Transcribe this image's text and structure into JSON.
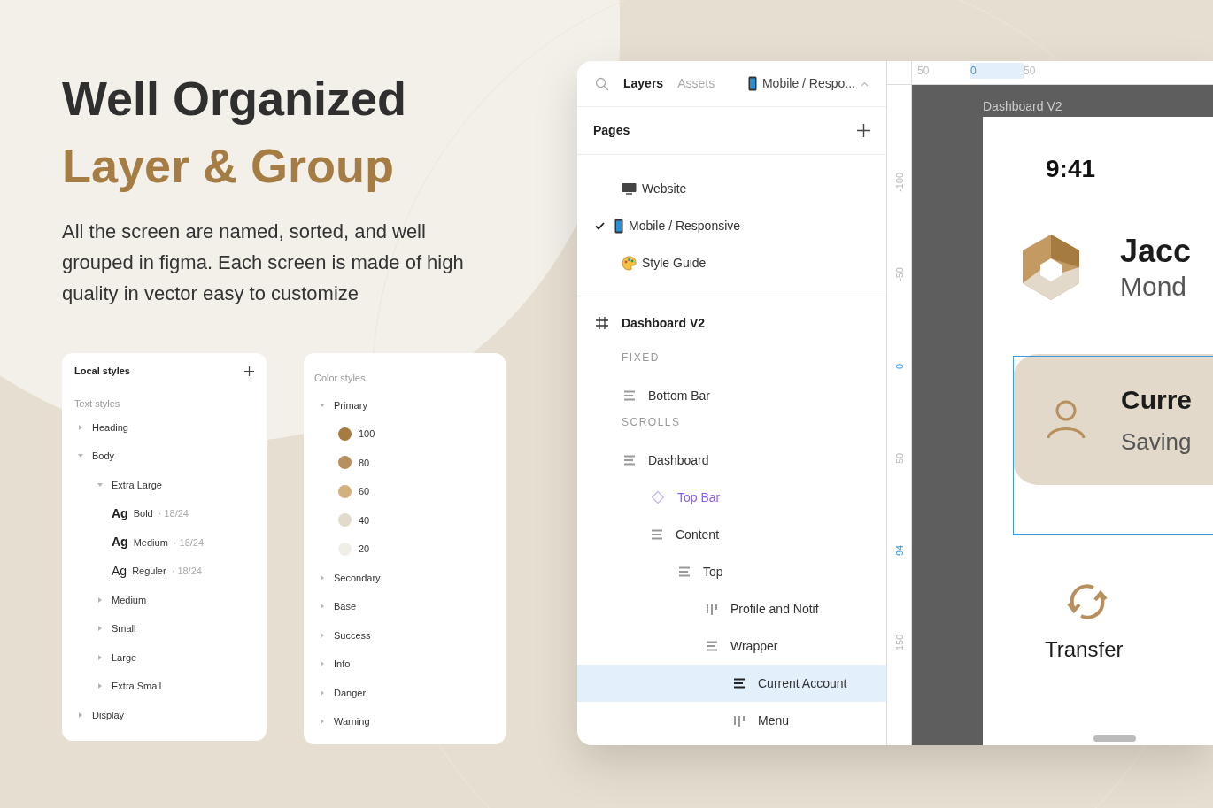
{
  "headline": {
    "line_1": "Well Organized",
    "line_2": "Layer & Group"
  },
  "description": "All the screen are named, sorted, and well grouped in figma. Each screen is made of high quality in vector easy to customize",
  "local_styles": {
    "title": "Local styles",
    "section": "Text styles",
    "items": [
      {
        "kind": "group",
        "label": "Heading",
        "expanded": false
      },
      {
        "kind": "group",
        "label": "Body",
        "expanded": true,
        "children": [
          {
            "kind": "group",
            "label": "Extra Large",
            "expanded": true,
            "children": [
              {
                "kind": "style",
                "sample": "Ag",
                "label": "Bold",
                "spec": "· 18/24"
              },
              {
                "kind": "style",
                "sample": "Ag",
                "label": "Medium",
                "spec": "· 18/24"
              },
              {
                "kind": "style",
                "sample": "Ag",
                "label": "Reguler",
                "spec": "· 18/24"
              }
            ]
          },
          {
            "kind": "group",
            "label": "Medium",
            "expanded": false
          },
          {
            "kind": "group",
            "label": "Small",
            "expanded": false
          },
          {
            "kind": "group",
            "label": "Large",
            "expanded": false
          },
          {
            "kind": "group",
            "label": "Extra Small",
            "expanded": false
          }
        ]
      },
      {
        "kind": "group",
        "label": "Display",
        "expanded": false
      }
    ]
  },
  "color_styles": {
    "title": "Color styles",
    "items": [
      {
        "kind": "group",
        "label": "Primary",
        "expanded": true,
        "children": [
          {
            "kind": "swatch",
            "label": "100",
            "color": "#a57b42"
          },
          {
            "kind": "swatch",
            "label": "80",
            "color": "#b8905e"
          },
          {
            "kind": "swatch",
            "label": "60",
            "color": "#d3b07f"
          },
          {
            "kind": "swatch",
            "label": "40",
            "color": "#e2dacd"
          },
          {
            "kind": "swatch",
            "label": "20",
            "color": "#f1eee8"
          }
        ]
      },
      {
        "kind": "group",
        "label": "Secondary",
        "expanded": false
      },
      {
        "kind": "group",
        "label": "Base",
        "expanded": false
      },
      {
        "kind": "group",
        "label": "Success",
        "expanded": false
      },
      {
        "kind": "group",
        "label": "Info",
        "expanded": false
      },
      {
        "kind": "group",
        "label": "Danger",
        "expanded": false
      },
      {
        "kind": "group",
        "label": "Warning",
        "expanded": false
      }
    ]
  },
  "figma": {
    "tabs": [
      {
        "label": "Layers",
        "selected": true
      },
      {
        "label": "Assets",
        "selected": false
      }
    ],
    "page_picker": "Mobile / Respo...",
    "pages_title": "Pages",
    "pages": [
      {
        "label": "Website",
        "kind": "desktop",
        "selected": false
      },
      {
        "label": "Mobile / Responsive",
        "kind": "phone",
        "selected": true
      },
      {
        "label": "Style Guide",
        "kind": "palette",
        "selected": false
      }
    ],
    "frame": "Dashboard V2",
    "sections": [
      {
        "label": "FIXED",
        "layers": [
          {
            "label": "Bottom Bar",
            "kind": "stack_v",
            "selected": false
          }
        ]
      },
      {
        "label": "SCROLLS",
        "layers": [
          {
            "label": "Dashboard",
            "kind": "stack_v",
            "selected": false,
            "children": [
              {
                "label": "Top Bar",
                "kind": "component",
                "selected": false
              },
              {
                "label": "Content",
                "kind": "stack_v",
                "selected": false,
                "children": [
                  {
                    "label": "Top",
                    "kind": "stack_v",
                    "selected": false,
                    "children": [
                      {
                        "label": "Profile and Notif",
                        "kind": "stack_h",
                        "selected": false
                      },
                      {
                        "label": "Wrapper",
                        "kind": "stack_v",
                        "selected": false,
                        "children": [
                          {
                            "label": "Current Account",
                            "kind": "stack_v",
                            "selected": true
                          },
                          {
                            "label": "Menu",
                            "kind": "stack_h",
                            "selected": false
                          }
                        ]
                      }
                    ]
                  }
                ]
              }
            ]
          }
        ]
      }
    ]
  },
  "canvas": {
    "ruler_top": [
      {
        "label": "50",
        "highlighted": false
      },
      {
        "label": "0",
        "highlighted": true
      },
      {
        "label": "50",
        "highlighted": false
      }
    ],
    "ruler_left": [
      {
        "label": "-100",
        "highlighted": false
      },
      {
        "label": "-50",
        "highlighted": false
      },
      {
        "label": "0",
        "highlighted": true
      },
      {
        "label": "50",
        "highlighted": false
      },
      {
        "label": "94",
        "highlighted": true
      },
      {
        "label": "150",
        "highlighted": false
      }
    ],
    "frame_label": "Dashboard V2",
    "time": "9:41",
    "name": "Jacc",
    "date": "Mond",
    "card_title": "Curre",
    "card_subtitle": "Saving",
    "action": "Transfer"
  }
}
